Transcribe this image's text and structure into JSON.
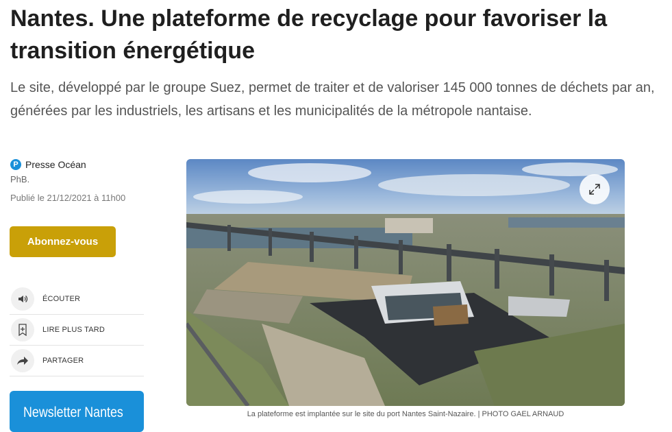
{
  "article": {
    "title": "Nantes. Une plateforme de recyclage pour favoriser la transition énergétique",
    "lede": "Le site, développé par le groupe Suez, permet de traiter et de valoriser 145 000 tonnes de déchets par an, générées par les industriels, les artisans et les municipalités de la métropole nantaise."
  },
  "meta": {
    "source_logo": "P",
    "source": "Presse Océan",
    "author": "PhB.",
    "published": "Publié le 21/12/2021 à 11h00"
  },
  "subscribe_label": "Abonnez-vous",
  "actions": [
    {
      "label": "ÉCOUTER",
      "icon": "speaker-icon"
    },
    {
      "label": "LIRE PLUS TARD",
      "icon": "bookmark-add-icon"
    },
    {
      "label": "PARTAGER",
      "icon": "share-arrow-icon"
    }
  ],
  "newsletter_label": "Newsletter Nantes",
  "photo": {
    "caption": "La plateforme est implantée sur le site du port Nantes Saint-Nazaire. | PHOTO GAEL ARNAUD",
    "expand_icon": "expand-icon"
  },
  "colors": {
    "subscribe": "#c9a008",
    "brand_blue": "#1a90d9"
  }
}
